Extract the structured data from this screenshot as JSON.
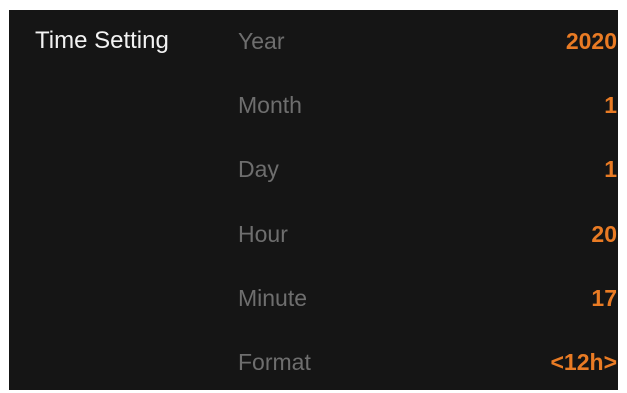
{
  "colors": {
    "background": "#151515",
    "title_text": "#f2f2f2",
    "label_text": "#6e6e6e",
    "value_accent": "#e97b24"
  },
  "menu": {
    "title": "Time Setting"
  },
  "settings": [
    {
      "label": "Year",
      "value": "2020"
    },
    {
      "label": "Month",
      "value": "1"
    },
    {
      "label": "Day",
      "value": "1"
    },
    {
      "label": "Hour",
      "value": "20"
    },
    {
      "label": "Minute",
      "value": "17"
    },
    {
      "label": "Format",
      "value": "<12h>"
    }
  ]
}
